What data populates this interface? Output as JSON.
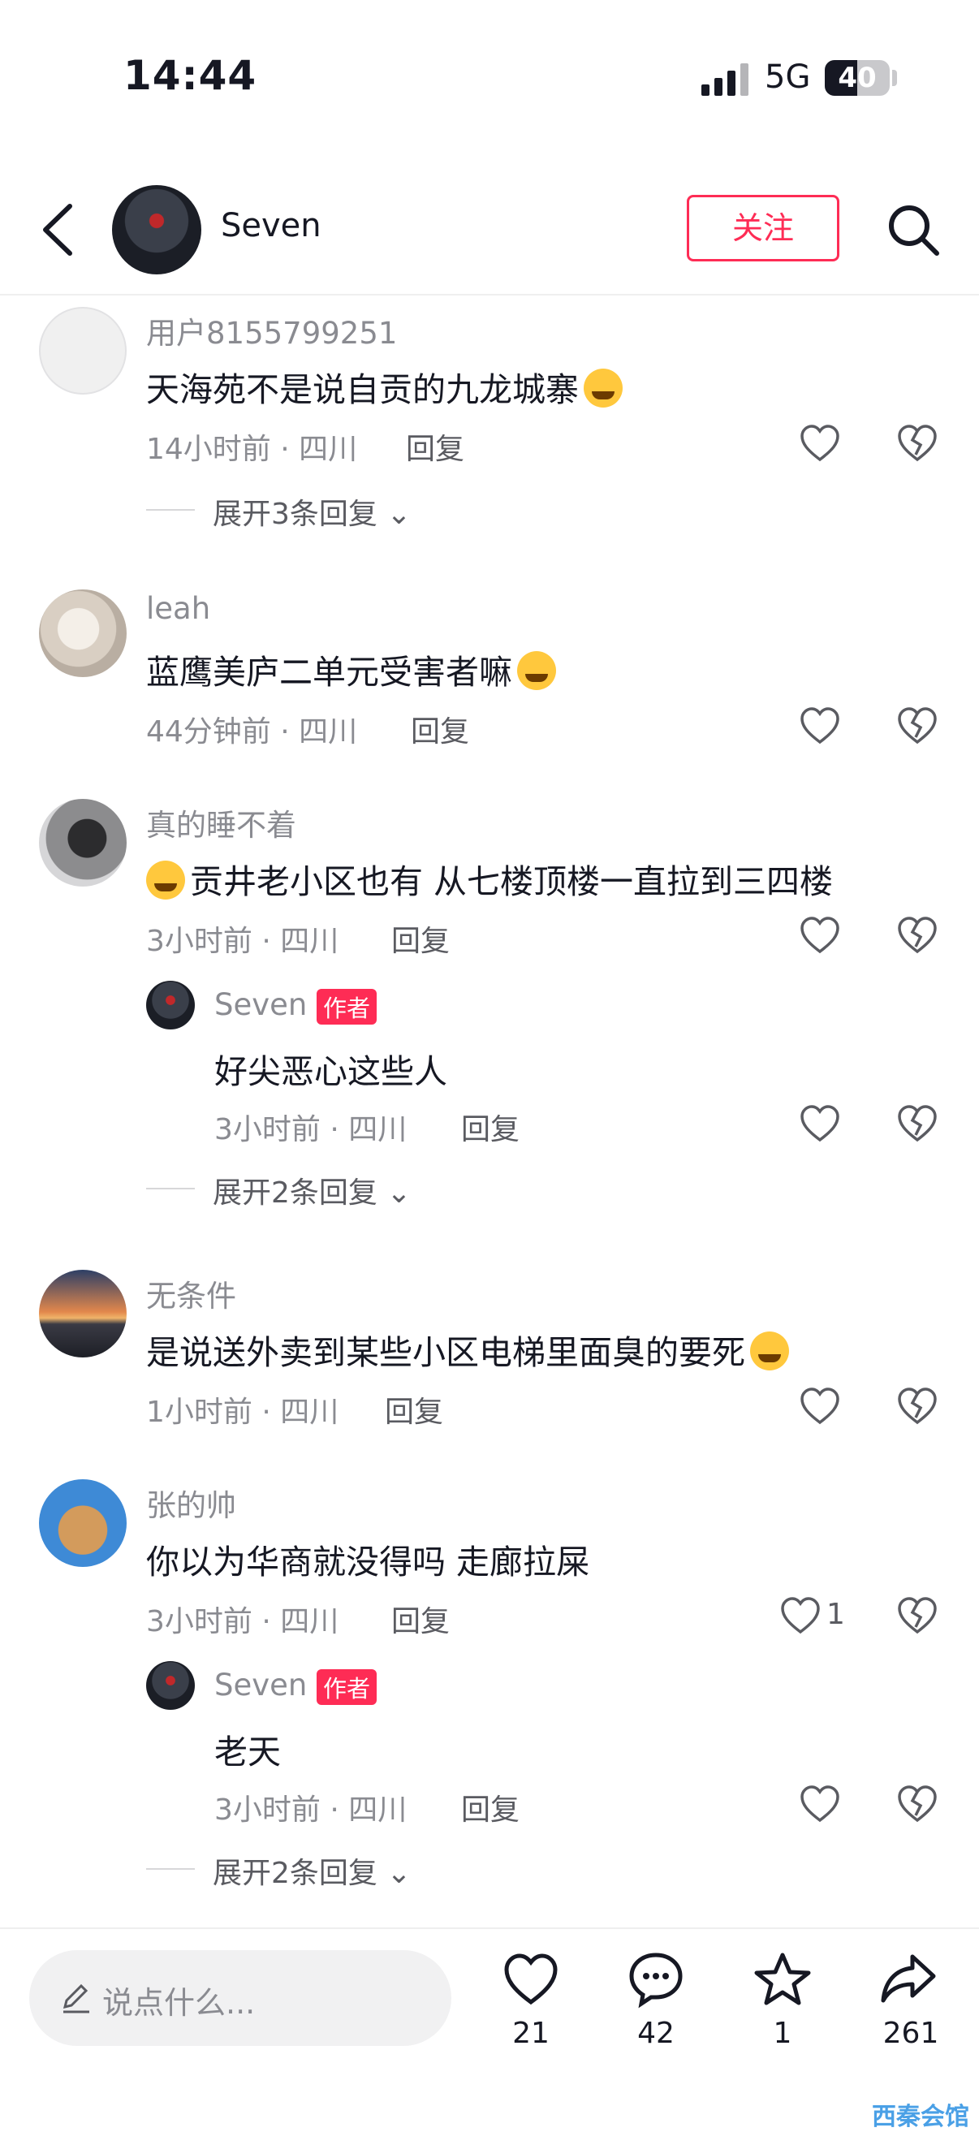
{
  "status_bar": {
    "time": "14:44",
    "network": "5G",
    "battery": "40"
  },
  "header": {
    "user_name": "Seven",
    "follow_label": "关注"
  },
  "comments": [
    {
      "username": "用户8155799251",
      "text": "天海苑不是说自贡的九龙城寨",
      "time": "14小时前 · 四川",
      "reply": "回复",
      "expand": "展开3条回复"
    },
    {
      "username": "leah",
      "text": "蓝鹰美庐二单元受害者嘛",
      "time": "44分钟前 · 四川",
      "reply": "回复"
    },
    {
      "username": "真的睡不着",
      "text": "贡井老小区也有 从七楼顶楼一直拉到三四楼",
      "time": "3小时前 · 四川",
      "reply": "回复",
      "sub_reply": {
        "username": "Seven",
        "tag": "作者",
        "text": "好尖恶心这些人",
        "time": "3小时前 · 四川",
        "reply": "回复"
      },
      "expand": "展开2条回复"
    },
    {
      "username": "无条件",
      "text": "是说送外卖到某些小区电梯里面臭的要死",
      "time": "1小时前 · 四川",
      "reply": "回复"
    },
    {
      "username": "张的帅",
      "text": "你以为华商就没得吗  走廊拉屎",
      "time": "3小时前 · 四川",
      "reply": "回复",
      "likes": "1",
      "sub_reply": {
        "username": "Seven",
        "tag": "作者",
        "text": "老天",
        "time": "3小时前 · 四川",
        "reply": "回复"
      },
      "expand": "展开2条回复"
    }
  ],
  "bottom_bar": {
    "input_placeholder": "说点什么...",
    "like_count": "21",
    "comment_count": "42",
    "favorite_count": "1",
    "share_count": "261"
  },
  "watermark": "西秦会馆",
  "icons": [
    "back-icon",
    "search-icon",
    "heart-icon",
    "dislike-icon",
    "chevron-down-icon",
    "pencil-icon",
    "comment-icon",
    "star-icon",
    "share-icon"
  ],
  "colors": {
    "accent": "#fe2c55",
    "text": "#161823",
    "secondary": "#8a8b91"
  }
}
